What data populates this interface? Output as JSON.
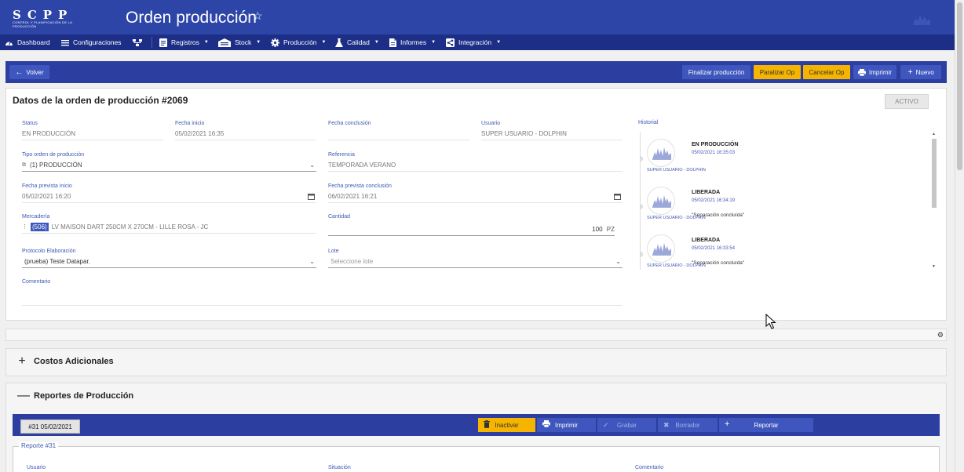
{
  "header": {
    "logo_text": "SCPP",
    "logo_subtitle": "CONTROL Y PLANIFICACIÓN DE LA PRODUCCIÓN",
    "title": "Orden producción",
    "star_icon": "star-outline-icon"
  },
  "nav": {
    "items": [
      {
        "label": "Dashboard",
        "icon": "dashboard-icon",
        "dropdown": false
      },
      {
        "label": "Configuraciones",
        "icon": "list-icon",
        "dropdown": false
      },
      {
        "label": "",
        "icon": "sitemap-icon",
        "dropdown": false
      },
      {
        "label": "Registros",
        "icon": "clipboard-icon",
        "dropdown": true
      },
      {
        "label": "Stock",
        "icon": "warehouse-icon",
        "dropdown": true
      },
      {
        "label": "Producción",
        "icon": "cog-icon",
        "dropdown": true
      },
      {
        "label": "Calidad",
        "icon": "flask-icon",
        "dropdown": true
      },
      {
        "label": "Informes",
        "icon": "file-icon",
        "dropdown": true
      },
      {
        "label": "Integración",
        "icon": "share-icon",
        "dropdown": true
      }
    ]
  },
  "toolbar": {
    "back_label": "Volver",
    "finalize_label": "Finalizar producción",
    "pause_label": "Paralizar Op",
    "cancel_label": "Cancelar Op",
    "print_label": "Imprimir",
    "new_label": "Nuevo"
  },
  "order": {
    "title": "Datos de la orden de producción #2069",
    "status_badge": "ACTIVO",
    "fields": {
      "status": {
        "label": "Status",
        "value": "EN PRODUCCIÓN"
      },
      "start_date": {
        "label": "Fecha inicio",
        "value": "05/02/2021 16:35"
      },
      "end_date": {
        "label": "Fecha conclusión",
        "value": ""
      },
      "user": {
        "label": "Usuario",
        "value": "SUPER USUARIO - DOLPHIN"
      },
      "order_type": {
        "label": "Tipo orden de producción",
        "value": "(1) PRODUCCIÓN"
      },
      "reference": {
        "label": "Referencia",
        "value": "TEMPORADA VERANO"
      },
      "planned_start": {
        "label": "Fecha prevista inicio",
        "value": "05/02/2021 16:20"
      },
      "planned_end": {
        "label": "Fecha prevista conclusión",
        "value": "06/02/2021 16:21"
      },
      "merchandise": {
        "label": "Mercadería",
        "code": "(506)",
        "value": "LV MAISON DART 250CM X 270CM - LILLE ROSA - JC"
      },
      "quantity": {
        "label": "Cantidad",
        "value": "100",
        "unit": "PZ"
      },
      "protocol": {
        "label": "Protocolo Elaboración",
        "value": "(prueba) Teste Datapar."
      },
      "lot": {
        "label": "Lote",
        "placeholder": "Seleccione lote"
      },
      "comment": {
        "label": "Comentario",
        "value": ""
      }
    }
  },
  "history": {
    "label": "Historial",
    "entries": [
      {
        "title": "EN PRODUCCIÓN",
        "date": "05/02/2021 16:35:03",
        "note": "",
        "user": "SUPER USUARIO - DOLPHIN"
      },
      {
        "title": "LIBERADA",
        "date": "05/02/2021 16:34:19",
        "note": "\"Separación concluída\"",
        "user": "SUPER USUARIO - DOLPHIN"
      },
      {
        "title": "LIBERADA",
        "date": "05/02/2021 16:33:54",
        "note": "\"Separación concluída\"",
        "user": "SUPER USUARIO - DOLPHIN"
      }
    ]
  },
  "panels": {
    "costs": {
      "sign": "+",
      "title": "Costos Adicionales"
    },
    "reports": {
      "sign": "—",
      "title": "Reportes de Producción"
    }
  },
  "report": {
    "tag": "#31 05/02/2021",
    "inactivate_label": "Inactivar",
    "print_label": "Imprimir",
    "save_label": "Grabar",
    "draft_label": "Borrador",
    "report_label": "Reportar",
    "legend": "Reporte #31",
    "columns": [
      "Usuario",
      "Situación",
      "Comentario"
    ]
  },
  "colors": {
    "header": "#2e45a8",
    "navbar": "#1c2e86",
    "toolbar": "#2c3fa0",
    "button_blue": "#3e56bd",
    "button_yellow": "#f5b400",
    "label_blue": "#4158b5"
  }
}
